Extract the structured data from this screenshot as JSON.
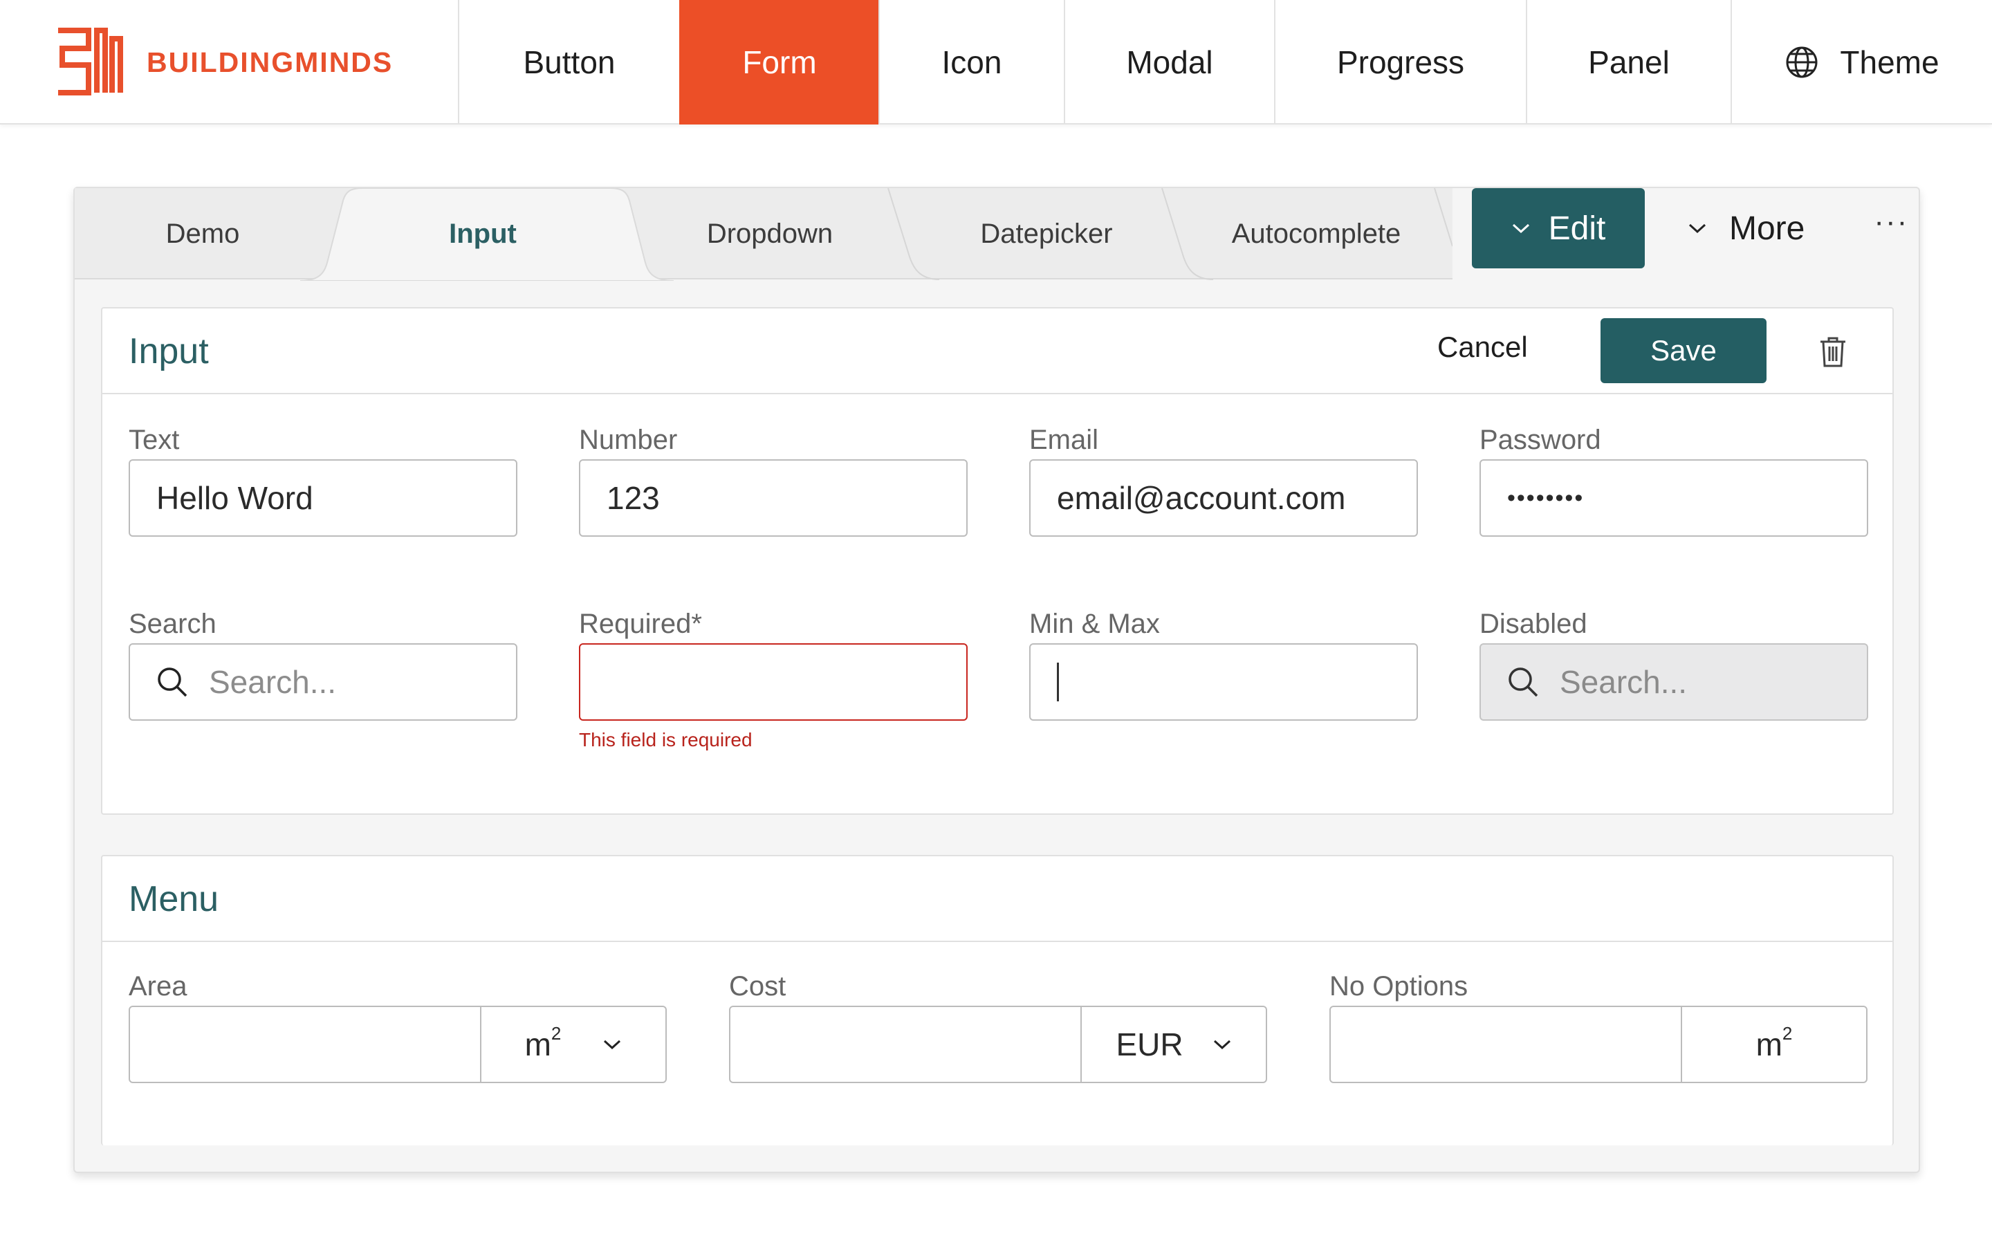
{
  "brand": {
    "name": "BUILDINGMINDS",
    "color": "#e8502c"
  },
  "nav": {
    "items": [
      {
        "label": "Button",
        "active": false
      },
      {
        "label": "Form",
        "active": true
      },
      {
        "label": "Icon",
        "active": false
      },
      {
        "label": "Modal",
        "active": false
      },
      {
        "label": "Progress",
        "active": false
      },
      {
        "label": "Panel",
        "active": false
      }
    ],
    "theme": {
      "label": "Theme",
      "icon": "globe-icon"
    },
    "active_color": "#ec4f27"
  },
  "tabs": [
    {
      "label": "Demo",
      "active": false
    },
    {
      "label": "Input",
      "active": true
    },
    {
      "label": "Dropdown",
      "active": false
    },
    {
      "label": "Datepicker",
      "active": false
    },
    {
      "label": "Autocomplete",
      "active": false
    }
  ],
  "actions": {
    "edit_label": "Edit",
    "more_label": "More",
    "overflow_label": "···",
    "primary_color": "#245e63"
  },
  "input_section": {
    "title": "Input",
    "cancel_label": "Cancel",
    "save_label": "Save",
    "fields": {
      "text": {
        "label": "Text",
        "value": "Hello Word"
      },
      "number": {
        "label": "Number",
        "value": "123"
      },
      "email": {
        "label": "Email",
        "value": "email@account.com"
      },
      "password": {
        "label": "Password",
        "value": "••••••••"
      },
      "search": {
        "label": "Search",
        "placeholder": "Search..."
      },
      "required": {
        "label": "Required*",
        "value": "",
        "error": "This field is required"
      },
      "minmax": {
        "label": "Min & Max",
        "value": ""
      },
      "disabled": {
        "label": "Disabled",
        "placeholder": "Search..."
      }
    }
  },
  "menu_section": {
    "title": "Menu",
    "fields": {
      "area": {
        "label": "Area",
        "value": "",
        "unit": "m",
        "unit_sup": "2"
      },
      "cost": {
        "label": "Cost",
        "value": "",
        "unit": "EUR"
      },
      "no_options": {
        "label": "No Options",
        "value": "",
        "unit": "m",
        "unit_sup": "2"
      }
    }
  }
}
